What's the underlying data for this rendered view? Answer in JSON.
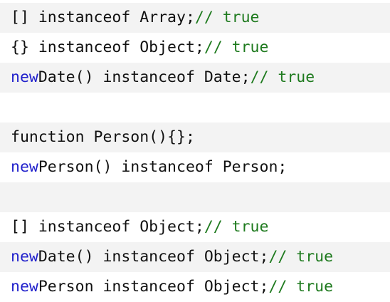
{
  "code": {
    "lines": [
      {
        "kw": "",
        "code": "[] instanceof Array;",
        "comment": "// true"
      },
      {
        "kw": "",
        "code": "{} instanceof Object;",
        "comment": "// true"
      },
      {
        "kw": "new",
        "code": "Date() instanceof Date;",
        "comment": "// true"
      },
      {
        "kw": "",
        "code": "",
        "comment": ""
      },
      {
        "kw": "",
        "code": "function Person(){};",
        "comment": ""
      },
      {
        "kw": "new",
        "code": "Person() instanceof Person;",
        "comment": ""
      },
      {
        "kw": "",
        "code": "",
        "comment": ""
      },
      {
        "kw": "",
        "code": "[] instanceof Object;",
        "comment": "// true"
      },
      {
        "kw": "new",
        "code": "Date() instanceof Object;",
        "comment": "// true"
      },
      {
        "kw": "new",
        "code": "Person instanceof Object;",
        "comment": "// true"
      }
    ]
  },
  "colors": {
    "keyword": "#2222cc",
    "comment": "#1e7a1e",
    "text": "#111111",
    "stripe": "#f3f3f3"
  }
}
